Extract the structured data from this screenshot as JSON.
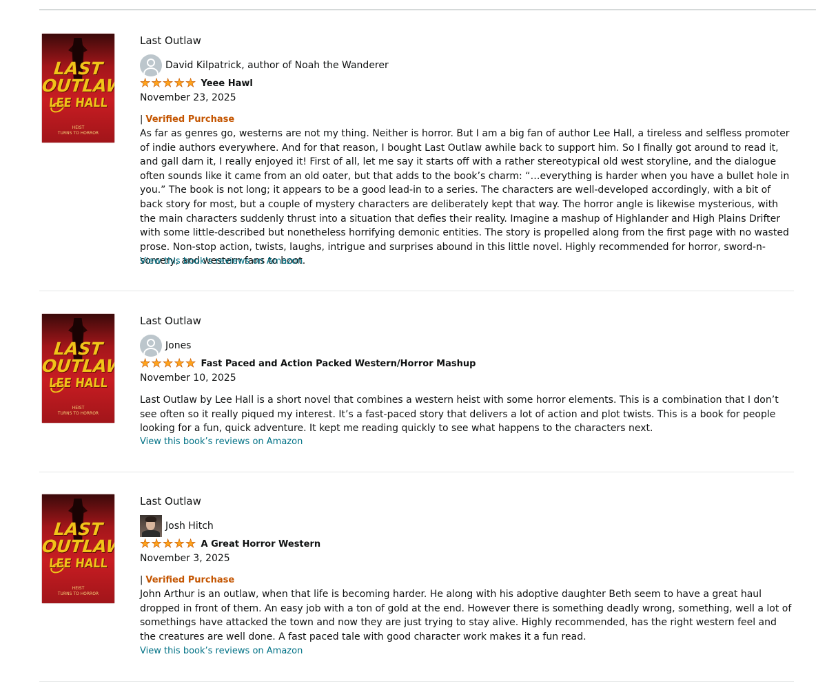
{
  "reviews": [
    {
      "book_title": "Last Outlaw",
      "reviewer": "David Kilpatrick, author of Noah the Wanderer",
      "avatar": "default-avatar-icon",
      "rating": 5,
      "headline": "Yeee Hawl",
      "date": "November 23, 2025",
      "verified": "Verified Purchase",
      "body": "As far as genres go, westerns are not my thing. Neither is horror. But I am a big fan of author Lee Hall, a tireless and selfless promoter of indie authors everywhere. And for that reason, I bought Last Outlaw awhile back to support him. So I finally got around to read it, and gall darn it, I really enjoyed it! First of all, let me say it starts off with a rather stereotypical old west storyline, and the dialogue often sounds like it came from an old oater, but that adds to the book’s charm: “…everything is harder when you have a bullet hole in you.” The book is not long; it appears to be a good lead-in to a series. The characters are well-developed accordingly, with a bit of back story for most, but a couple of mystery characters are deliberately kept that way. The horror angle is likewise mysterious, with the main characters suddenly thrust into a situation that defies their reality. Imagine a mashup of Highlander and High Plains Drifter with some little-described but nonetheless horrifying demonic entities. The story is propelled along from the first page with no wasted prose. Non-stop action, twists, laughs, intrigue and surprises abound in this little novel. Highly recommended for horror, sword-n-sorcery, and western fans to boot.",
      "link": "View this book’s reviews on Amazon"
    },
    {
      "book_title": "Last Outlaw",
      "reviewer": "Jones",
      "avatar": "default-avatar-icon",
      "rating": 5,
      "headline": "Fast Paced and Action Packed Western/Horror Mashup",
      "date": "November 10, 2025",
      "verified": "",
      "body": "Last Outlaw by Lee Hall is a short novel that combines a western heist with some horror elements. This is a combination that I don’t see often so it really piqued my interest. It’s a fast-paced story that delivers a lot of action and plot twists. This is a book for people looking for a fun, quick adventure. It kept me reading quickly to see what happens to the characters next.",
      "link": "View this book’s reviews on Amazon"
    },
    {
      "book_title": "Last Outlaw",
      "reviewer": "Josh Hitch",
      "avatar": "profile-photo",
      "rating": 5,
      "headline": "A Great Horror Western",
      "date": "November 3, 2025",
      "verified": "Verified Purchase",
      "body": "John Arthur is an outlaw, when that life is becoming harder. He along with his adoptive daughter Beth seem to have a great haul dropped in front of them. An easy job with a ton of gold at the end. However there is something deadly wrong, something, well a lot of somethings have attacked the town and now they are just trying to stay alive. Highly recommended, has the right western feel and the creatures are well done. A fast paced tale with good character work makes it a fun read.",
      "link": "View this book’s reviews on Amazon"
    }
  ],
  "cover": {
    "title_line1": "LAST",
    "title_line2": "OUTLAW",
    "author": "LEE HALL",
    "tagline": "HEIST\nTURNS TO HORROR"
  },
  "colors": {
    "link": "#007185",
    "verified": "#c45500",
    "star": "#ffa41c",
    "cover_red": "#c81d22",
    "cover_gold": "#f0c419"
  }
}
